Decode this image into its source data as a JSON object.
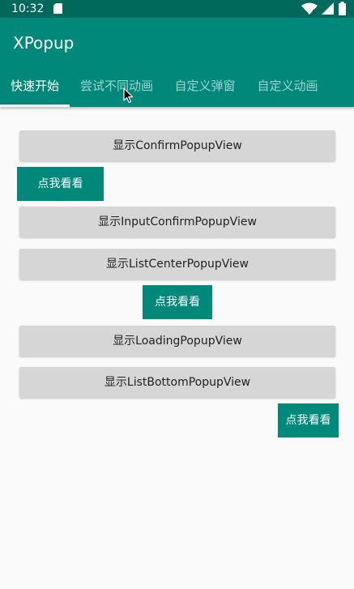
{
  "status_bar": {
    "time": "10:32",
    "icons": [
      "sd-card-icon",
      "wifi-icon",
      "signal-icon",
      "battery-icon"
    ]
  },
  "app_bar": {
    "title": "XPopup"
  },
  "tabs": [
    {
      "label": "快速开始",
      "active": true
    },
    {
      "label": "尝试不同动画",
      "active": false
    },
    {
      "label": "自定义弹窗",
      "active": false
    },
    {
      "label": "自定义动画",
      "active": false
    }
  ],
  "content": {
    "confirm_button": "显示ConfirmPopupView",
    "peek_button_1": "点我看看",
    "input_confirm_button": "显示InputConfirmPopupView",
    "list_center_button": "显示ListCenterPopupView",
    "peek_button_2": "点我看看",
    "loading_button": "显示LoadingPopupView",
    "list_bottom_button": "显示ListBottomPopupView",
    "peek_button_3": "点我看看"
  },
  "colors": {
    "primary_dark": "#00695c",
    "primary": "#00897b",
    "button_gray": "#d6d6d6",
    "background": "#fafafa"
  }
}
